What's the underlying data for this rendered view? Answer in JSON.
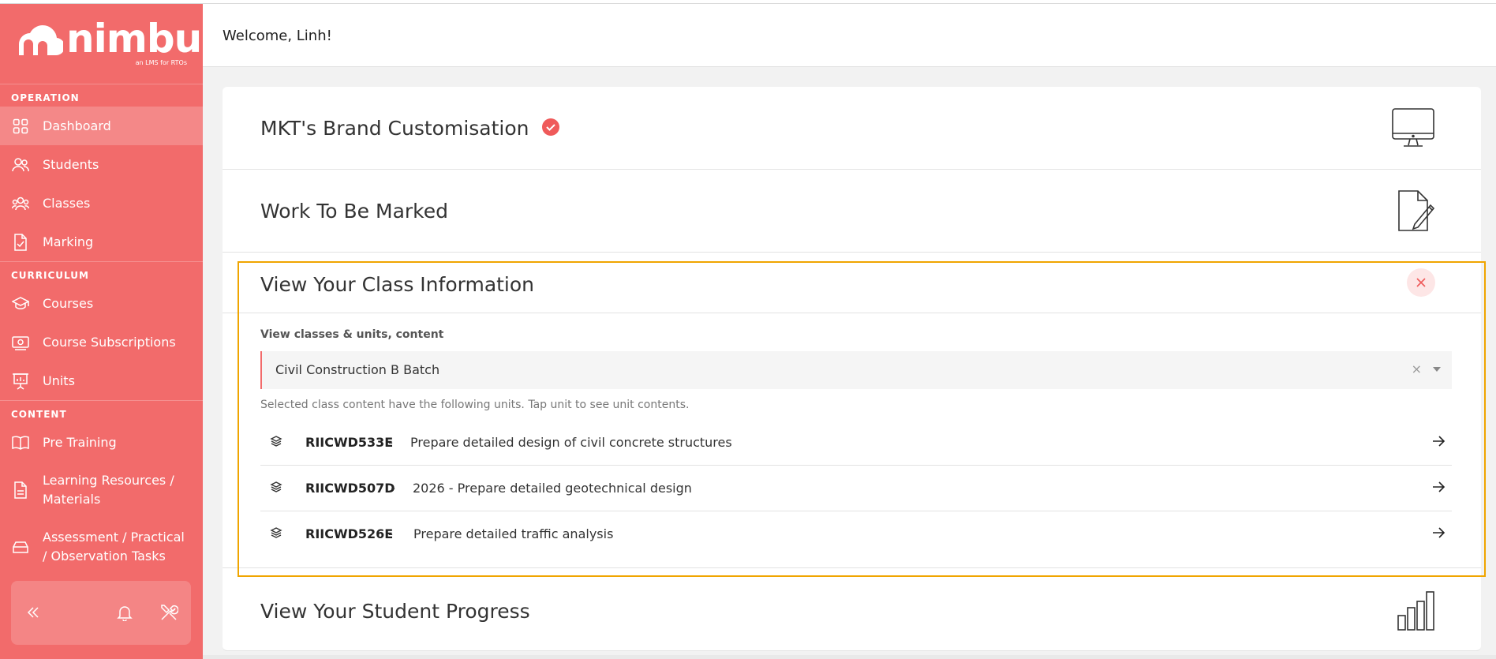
{
  "sidebar": {
    "logo_text": "nimbu",
    "logo_tagline": "an LMS for RTOs",
    "sections": {
      "operation": "OPERATION",
      "curriculum": "CURRICULUM",
      "content": "CONTENT"
    },
    "items": {
      "dashboard": "Dashboard",
      "students": "Students",
      "classes": "Classes",
      "marking": "Marking",
      "courses": "Courses",
      "course_subscriptions": "Course Subscriptions",
      "units": "Units",
      "pre_training": "Pre Training",
      "learning_resources": "Learning Resources / Materials",
      "assessment": "Assessment / Practical / Observation Tasks"
    },
    "active_item": "dashboard",
    "color": "#f26b6b"
  },
  "header": {
    "welcome": "Welcome, Linh!"
  },
  "cards": {
    "brand": {
      "title": "MKT's Brand Customisation",
      "icon": "monitor-icon",
      "verified": true
    },
    "marking": {
      "title": "Work To Be Marked",
      "icon": "document-edit-icon"
    },
    "class_info": {
      "title": "View Your Class Information",
      "field_label": "View classes & units, content",
      "selected_class": "Civil Construction B Batch",
      "clear_symbol": "×",
      "hint": "Selected class content have the following units. Tap unit to see unit contents.",
      "units": [
        {
          "code": "RIICWD533E",
          "separator": " -  ",
          "name": "Prepare detailed design of civil concrete structures"
        },
        {
          "code": "RIICWD507D",
          "separator": " -  ",
          "name": "2026 - Prepare detailed geotechnical design"
        },
        {
          "code": "RIICWD526E",
          "separator": " -   ",
          "name": "Prepare detailed traffic analysis"
        }
      ]
    },
    "progress": {
      "title": "View Your Student Progress",
      "icon": "bar-chart-icon"
    }
  },
  "colors": {
    "accent": "#f26b6b",
    "highlight": "#f0a500"
  }
}
